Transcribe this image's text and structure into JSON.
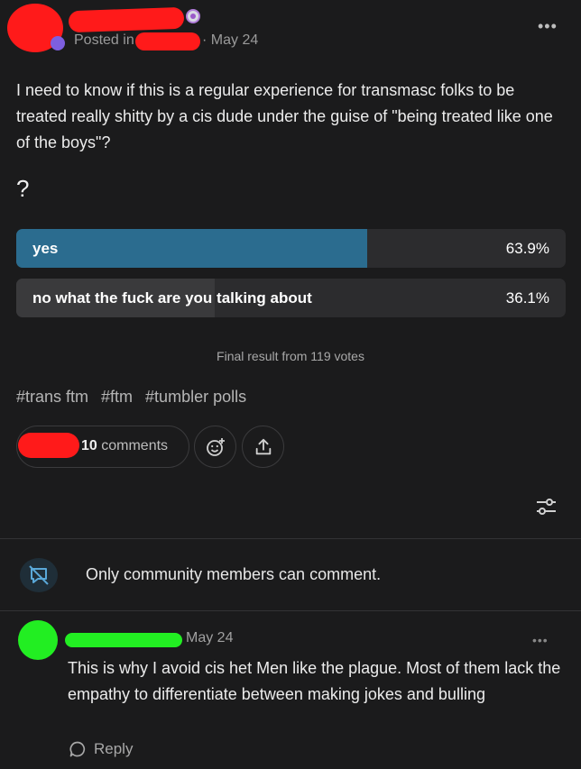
{
  "post": {
    "posted_in_label": "Posted in",
    "date": "· May 24",
    "more_label": "•••",
    "body": "I need to know if this is a regular experience for transmasc folks to be treated really shitty by a cis dude under the guise of \"being treated like one of the boys\"?",
    "question": "?"
  },
  "poll": {
    "options": [
      {
        "label": "yes",
        "percent_text": "63.9%",
        "percent": 63.9
      },
      {
        "label": "no what the fuck are you talking about",
        "percent_text": "36.1%",
        "percent": 36.1
      }
    ],
    "final_result": "Final result from 119 votes"
  },
  "tags": [
    "#trans ftm",
    "#ftm",
    "#tumbler polls"
  ],
  "actions": {
    "comment_count": "10",
    "comment_word": " comments"
  },
  "community_notice": "Only community members can comment.",
  "reply": {
    "date": "May 24",
    "more_label": "•••",
    "text": "This is why I avoid cis het Men like the plague. Most of them lack the empathy to differentiate between making jokes and bulling",
    "reply_label": "Reply"
  },
  "colors": {
    "poll_fill": "#2b6c8f",
    "redaction_red": "#ff1a1a",
    "redaction_green": "#22ee22"
  }
}
